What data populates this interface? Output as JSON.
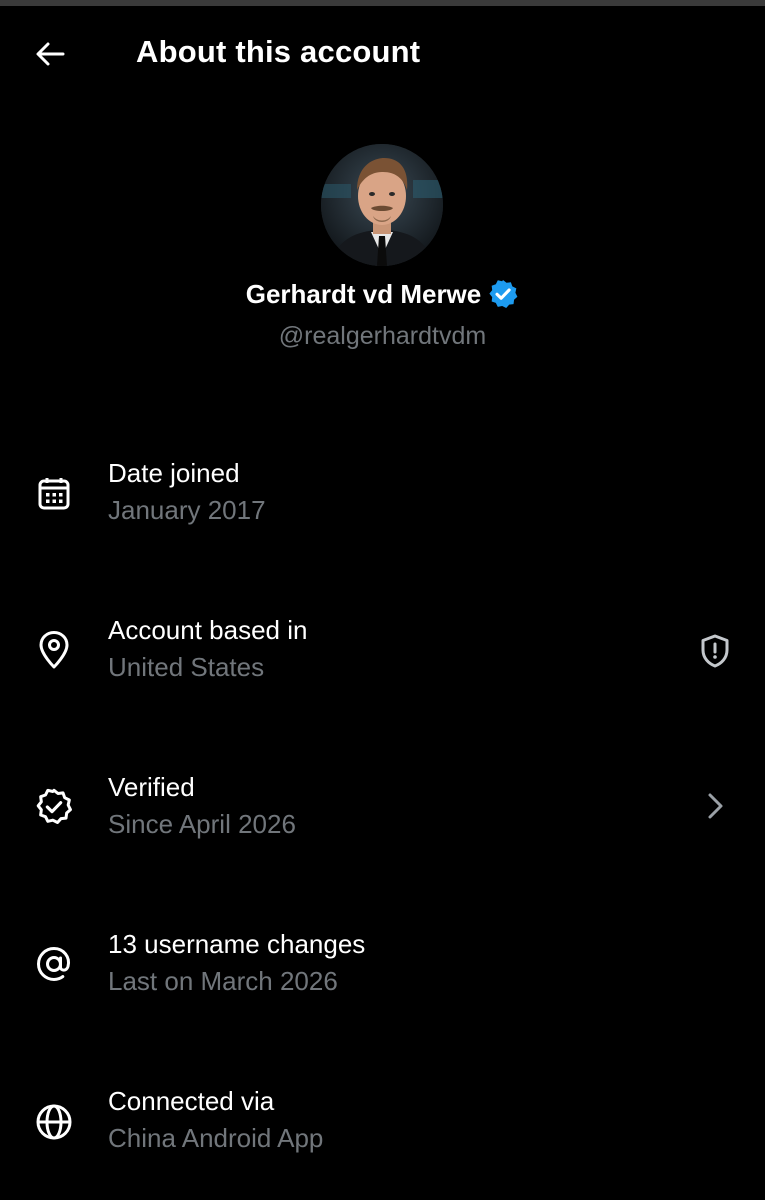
{
  "header": {
    "back_icon": "arrow-left-icon",
    "title": "About this account"
  },
  "profile": {
    "display_name": "Gerhardt vd Merwe",
    "handle": "@realgerhardtvdm",
    "verified_badge_icon": "verified-badge-icon",
    "verified_color": "#1d9bf0"
  },
  "rows": [
    {
      "icon": "calendar-icon",
      "title": "Date joined",
      "subtitle": "January 2017",
      "trailing_icon": ""
    },
    {
      "icon": "location-pin-icon",
      "title": "Account based in",
      "subtitle": "United States",
      "trailing_icon": "shield-alert-icon"
    },
    {
      "icon": "verified-check-icon",
      "title": "Verified",
      "subtitle": "Since April 2026",
      "trailing_icon": "chevron-right-icon"
    },
    {
      "icon": "at-sign-icon",
      "title": "13 username changes",
      "subtitle": "Last on March 2026",
      "trailing_icon": ""
    },
    {
      "icon": "globe-icon",
      "title": "Connected via",
      "subtitle": "China Android App",
      "trailing_icon": ""
    }
  ],
  "colors": {
    "background": "#000000",
    "primary_text": "#ffffff",
    "secondary_text": "#71767b",
    "accent": "#1d9bf0"
  }
}
